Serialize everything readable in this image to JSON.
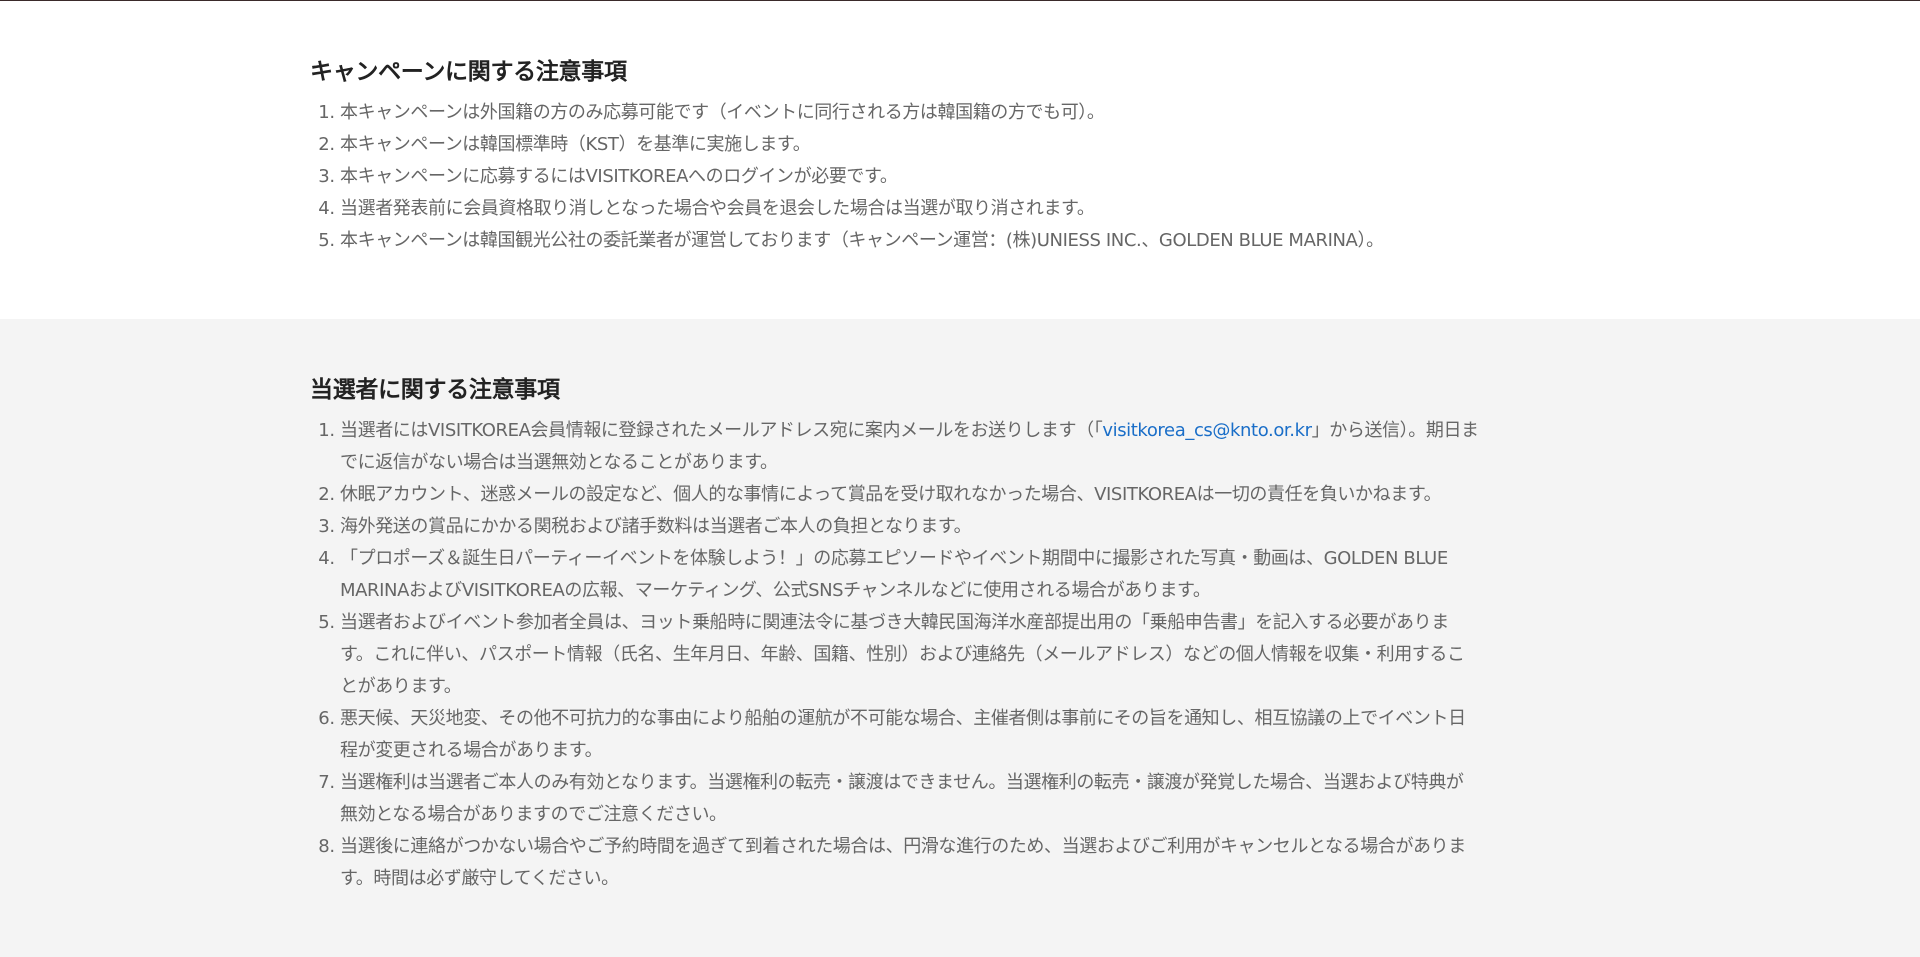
{
  "campaign_notes": {
    "title": "キャンペーンに関する注意事項",
    "items": [
      "本キャンペーンは外国籍の方のみ応募可能です（イベントに同行される方は韓国籍の方でも可）。",
      "本キャンペーンは韓国標準時（KST）を基準に実施します。",
      "本キャンペーンに応募するにはVISITKOREAへのログインが必要です。",
      "当選者発表前に会員資格取り消しとなった場合や会員を退会した場合は当選が取り消されます。",
      "本キャンペーンは韓国観光公社の委託業者が運営しております（キャンペーン運営：(株)UNIESS INC.、GOLDEN BLUE MARINA）。"
    ]
  },
  "winner_notes": {
    "title": "当選者に関する注意事項",
    "item1": {
      "before": "当選者にはVISITKOREA会員情報に登録されたメールアドレス宛に案内メールをお送りします（「",
      "email": "visitkorea_cs@knto.or.kr",
      "after_line1": "」から送信）。期日ま",
      "line2": "でに返信がない場合は当選無効となることがあります。"
    },
    "item2": "休眠アカウント、迷惑メールの設定など、個人的な事情によって賞品を受け取れなかった場合、VISITKOREAは一切の責任を負いかねます。",
    "item3": "海外発送の賞品にかかる関税および諸手数料は当選者ご本人の負担となります。",
    "item4": {
      "line1": "「プロポーズ＆誕生日パーティーイベントを体験しよう！」の応募エピソードやイベント期間中に撮影された写真・動画は、GOLDEN BLUE",
      "line2": "MARINAおよびVISITKOREAの広報、マーケティング、公式SNSチャンネルなどに使用される場合があります。"
    },
    "item5": {
      "line1": "当選者およびイベント参加者全員は、ヨット乗船時に関連法令に基づき大韓民国海洋水産部提出用の「乗船申告書」を記入する必要がありま",
      "line2": "す。これに伴い、パスポート情報（氏名、生年月日、年齢、国籍、性別）および連絡先（メールアドレス）などの個人情報を収集・利用するこ",
      "line3": "とがあります。"
    },
    "item6": {
      "line1": "悪天候、天災地変、その他不可抗力的な事由により船舶の運航が不可能な場合、主催者側は事前にその旨を通知し、相互協議の上でイベント日",
      "line2": "程が変更される場合があります。"
    },
    "item7": {
      "line1": "当選権利は当選者ご本人のみ有効となります。当選権利の転売・譲渡はできません。当選権利の転売・譲渡が発覚した場合、当選および特典が",
      "line2": "無効となる場合がありますのでご注意ください。"
    },
    "item8": {
      "line1": "当選後に連絡がつかない場合やご予約時間を過ぎて到着された場合は、円滑な進行のため、当選およびご利用がキャンセルとなる場合がありま",
      "line2": "す。時間は必ず厳守してください。"
    }
  },
  "colors": {
    "heading": "#222222",
    "body_text": "#666666",
    "link": "#1a6ec8",
    "gray_bg": "#f4f4f4"
  }
}
